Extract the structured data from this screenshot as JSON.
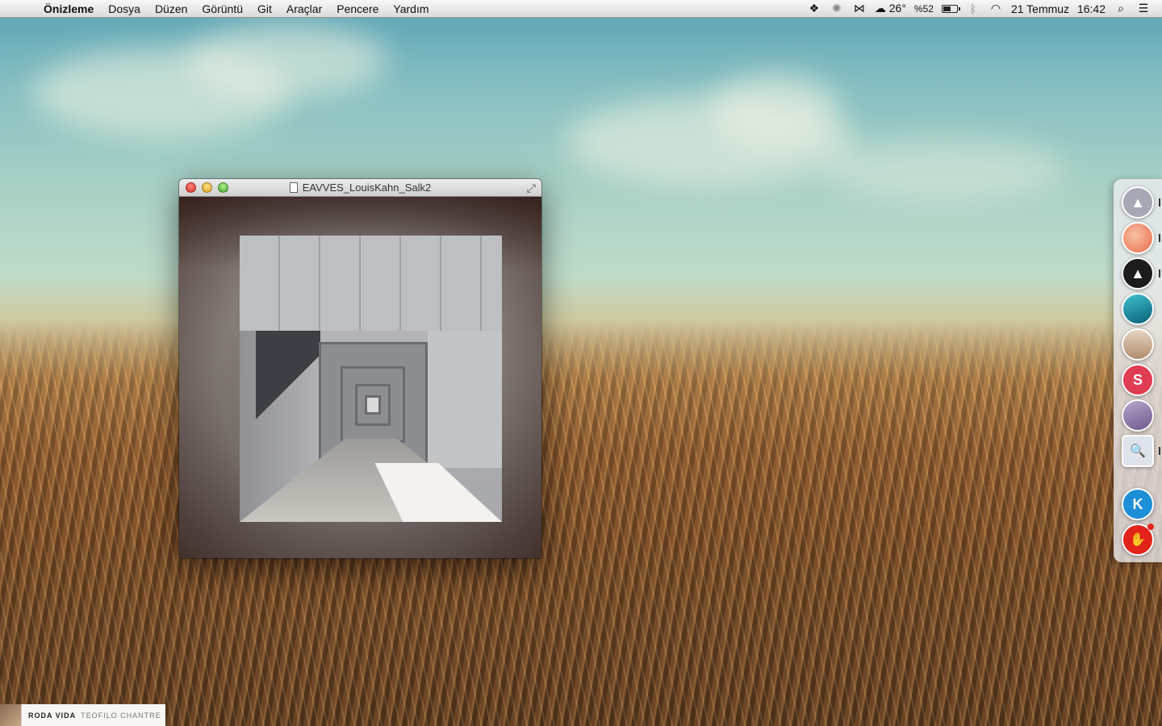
{
  "menubar": {
    "apple": "",
    "app_name": "Önizleme",
    "items": [
      "Dosya",
      "Düzen",
      "Görüntü",
      "Git",
      "Araçlar",
      "Pencere",
      "Yardım"
    ],
    "tray": {
      "weather_temp": "26°",
      "battery_percent": "%52",
      "battery_level": 0.52,
      "date": "21 Temmuz",
      "time": "16:42"
    }
  },
  "window": {
    "title": "EAVVES_LouisKahn_Salk2"
  },
  "dock": {
    "apps": [
      {
        "name": "Launchpad",
        "color": "#a6a8b6",
        "glyph": "▲",
        "running": true
      },
      {
        "name": "Photo app",
        "color": "#f07a5a",
        "glyph": "",
        "running": true
      },
      {
        "name": "Triangle app",
        "color": "#1c1c1c",
        "glyph": "▲",
        "running": true
      },
      {
        "name": "Wave app",
        "color": "#1698a8",
        "glyph": "",
        "running": false
      },
      {
        "name": "Sand app",
        "color": "#d8c0a8",
        "glyph": "",
        "running": false
      },
      {
        "name": "S app",
        "color": "#e03c52",
        "glyph": "S",
        "running": false
      },
      {
        "name": "Bear app",
        "color": "#9a8ab0",
        "glyph": "",
        "running": false
      },
      {
        "name": "Preview",
        "color": "#dfe4ec",
        "glyph": "🔍",
        "running": true
      },
      {
        "name": "K app",
        "color": "#1d8fd6",
        "glyph": "K",
        "running": false
      },
      {
        "name": "Hand app",
        "color": "#e2231a",
        "glyph": "✋",
        "running": false,
        "badge": true
      }
    ]
  },
  "now_playing": {
    "title": "RODA VIDA",
    "artist": "TEOFILO CHANTRE"
  }
}
